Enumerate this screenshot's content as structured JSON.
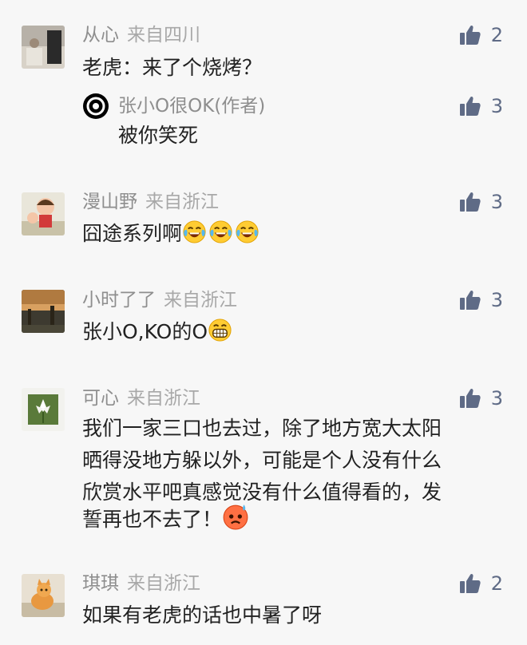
{
  "comments": [
    {
      "user": "从心",
      "location": "来自四川",
      "likes": "2",
      "text": "老虎：来了个烧烤？",
      "reply": {
        "user": "张小O很OK(作者)",
        "likes": "3",
        "text": "被你笑死"
      }
    },
    {
      "user": "漫山野",
      "location": "来自浙江",
      "likes": "3",
      "text": "囧途系列啊"
    },
    {
      "user": "小时了了",
      "location": "来自浙江",
      "likes": "3",
      "text": "张小O,KO的O"
    },
    {
      "user": "可心",
      "location": "来自浙江",
      "likes": "3",
      "lines": [
        "我们一家三口也去过，除了地方宽大太阳",
        "晒得没地方躲以外，可能是个人没有什么",
        "欣赏水平吧真感觉没有什么值得看的，发",
        "誓再也不去了！"
      ]
    },
    {
      "user": "琪琪",
      "location": "来自浙江",
      "likes": "2",
      "text": "如果有老虎的话也中暑了呀"
    }
  ],
  "colors": {
    "background": "#f7f7f7",
    "like": "#5f6b86",
    "name": "#8e8e8e",
    "text": "#222222"
  },
  "icons": [
    "thumbs-up-icon",
    "laughing-crying-emoji",
    "grinning-emoji",
    "angry-sweat-emoji"
  ]
}
